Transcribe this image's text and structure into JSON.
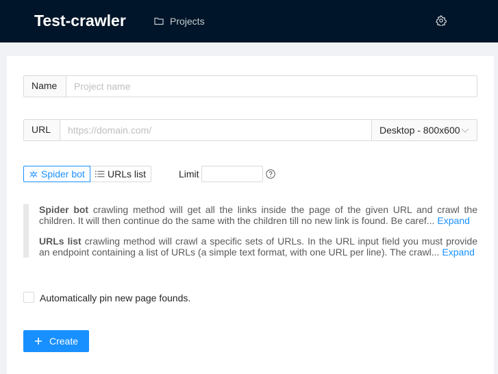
{
  "header": {
    "app_title": "Test-crawler",
    "nav_projects_label": "Projects",
    "background_color": "#001529"
  },
  "form": {
    "name": {
      "label": "Name",
      "placeholder": "Project name",
      "value": ""
    },
    "url": {
      "label": "URL",
      "placeholder": "https://domain.com/",
      "value": ""
    },
    "viewport_select": {
      "selected": "Desktop - 800x600"
    },
    "method_options": [
      {
        "label": "Spider bot",
        "icon": "spider-icon",
        "selected": true
      },
      {
        "label": "URLs list",
        "icon": "list-icon",
        "selected": false
      }
    ],
    "limit": {
      "label": "Limit",
      "value": ""
    },
    "descriptions": [
      {
        "term": "Spider bot",
        "text": " crawling method will get all the links inside the page of the given URL and crawl the children. It will then continue do the same with the children till no new link is found. Be caref...",
        "expand_label": "Expand"
      },
      {
        "term": "URLs list",
        "text": " crawling method will crawl a specific sets of URLs. In the URL input field you must provide an endpoint containing a list of URLs (a simple text format, with one URL per line). The crawl...",
        "expand_label": "Expand"
      }
    ],
    "autopin": {
      "label": "Automatically pin new page founds.",
      "checked": false
    },
    "create_button_label": "Create"
  },
  "colors": {
    "primary": "#1890ff",
    "page_background": "#f0f2f5"
  }
}
